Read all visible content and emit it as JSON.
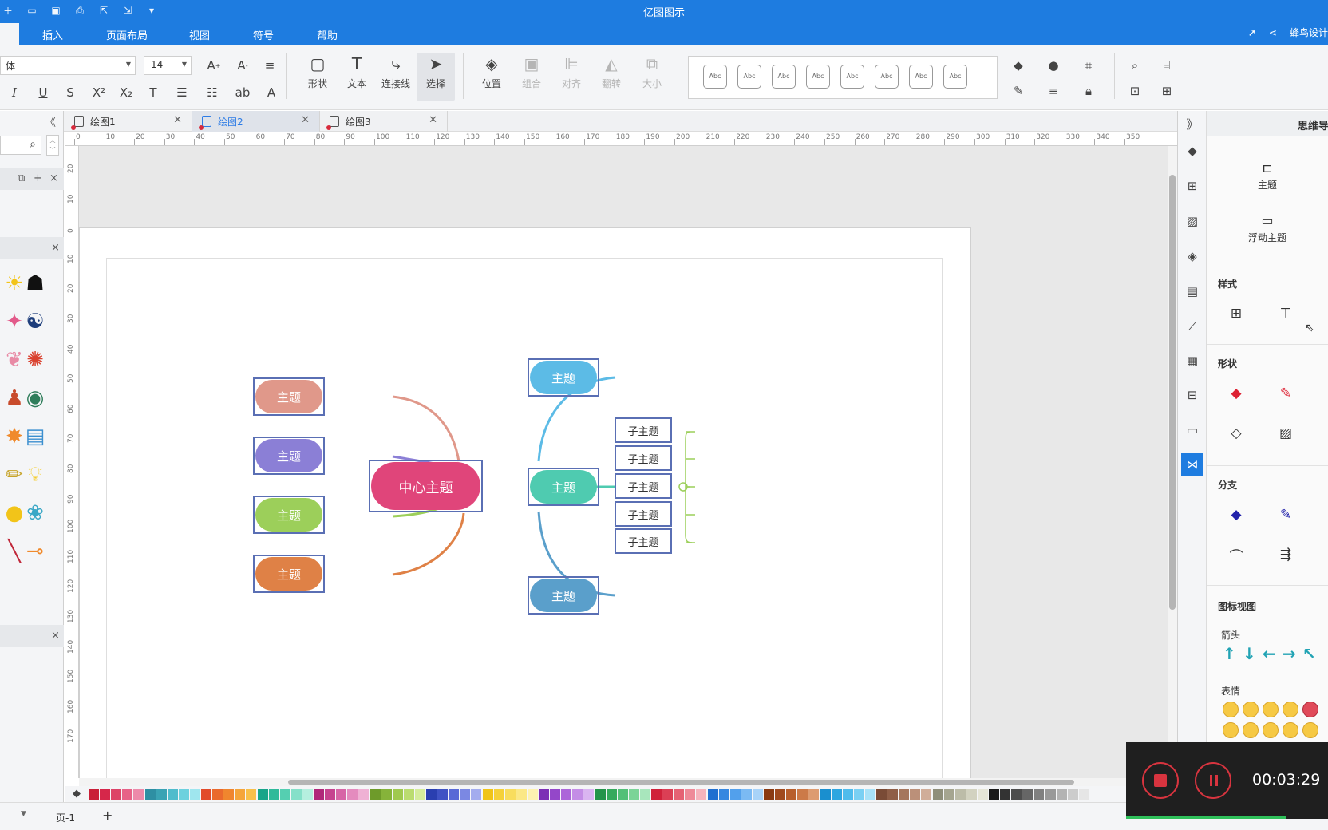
{
  "app": {
    "title": "亿图图示"
  },
  "menu": {
    "items": [
      "插入",
      "页面布局",
      "视图",
      "符号",
      "帮助"
    ],
    "user": "蜂鸟设计"
  },
  "ribbon": {
    "font_name": "体",
    "font_size": "14",
    "tools": {
      "shape": "形状",
      "text": "文本",
      "connector": "连接线",
      "select": "选择",
      "position": "位置",
      "group": "组合",
      "align": "对齐",
      "flip": "翻转",
      "size": "大小"
    },
    "style_chip": "Abc"
  },
  "tabs": [
    {
      "label": "绘图1"
    },
    {
      "label": "绘图2"
    },
    {
      "label": "绘图3"
    }
  ],
  "ruler": {
    "h": [
      "0",
      "10",
      "20",
      "30",
      "40",
      "50",
      "60",
      "70",
      "80",
      "90",
      "100",
      "110",
      "120",
      "130",
      "140",
      "150",
      "160",
      "170",
      "180",
      "190",
      "200",
      "210",
      "220",
      "230",
      "240",
      "250",
      "260",
      "270",
      "280",
      "290",
      "300",
      "310",
      "320",
      "330",
      "340",
      "350"
    ],
    "v": [
      "20",
      "10",
      "0",
      "10",
      "20",
      "30",
      "40",
      "50",
      "60",
      "70",
      "80",
      "90",
      "100",
      "110",
      "120",
      "130",
      "140",
      "150",
      "160",
      "170"
    ]
  },
  "mindmap": {
    "center": "中心主题",
    "left_topics": [
      {
        "label": "主题",
        "color": "#e0988a"
      },
      {
        "label": "主题",
        "color": "#8b7fd6"
      },
      {
        "label": "主题",
        "color": "#9ccf5a"
      },
      {
        "label": "主题",
        "color": "#df8146"
      }
    ],
    "right_topics": [
      {
        "label": "主题",
        "color": "#5cbbe6"
      },
      {
        "label": "主题",
        "color": "#4fcbb0"
      },
      {
        "label": "主题",
        "color": "#5a9fcb"
      }
    ],
    "subtopics": [
      "子主题",
      "子主题",
      "子主题",
      "子主题",
      "子主题"
    ],
    "center_color": "#e0457a"
  },
  "rightpanel": {
    "title": "思维导",
    "topic_btn": "主题",
    "float_topic_btn": "浮动主题",
    "sections": {
      "style": "样式",
      "shape": "形状",
      "branch": "分支",
      "icon_view": "图标视图"
    },
    "subs": {
      "arrow": "箭头",
      "emoji": "表情"
    }
  },
  "statusbar": {
    "page": "页-1",
    "add": "+"
  },
  "recorder": {
    "time": "00:03:29"
  },
  "palette": [
    "#c91f37",
    "#d6274a",
    "#dd4367",
    "#e76287",
    "#ed8aaa",
    "#2e8fa3",
    "#3aa3b4",
    "#4fbccc",
    "#6dd1de",
    "#9fe6ee",
    "#e24b2a",
    "#ea6a2d",
    "#f0862e",
    "#f5a53a",
    "#f8c04a",
    "#18a589",
    "#2fba9a",
    "#55cfb1",
    "#85e0c9",
    "#b5efdf",
    "#b0287a",
    "#c6438f",
    "#d765a6",
    "#e48bbe",
    "#efb1d4",
    "#6e9b2a",
    "#86b33a",
    "#a0c94f",
    "#bbdc70",
    "#d5ec9c",
    "#2a3fb0",
    "#3f52c4",
    "#5969d6",
    "#7b88e3",
    "#a3acee",
    "#f0c419",
    "#f5d13a",
    "#f8dd5e",
    "#fbe886",
    "#fdf2b2",
    "#7c2fb5",
    "#9447c9",
    "#ac66d9",
    "#c48de6",
    "#dab5f1",
    "#24944a",
    "#35aa5c",
    "#52c077",
    "#7bd497",
    "#a8e6bc",
    "#d0213a",
    "#db3f55",
    "#e56274",
    "#ee8a98",
    "#f5b3bc",
    "#1f6fd0",
    "#3587e0",
    "#52a0ec",
    "#7bbaf3",
    "#a8d3f8",
    "#8a3b12",
    "#a04a1d",
    "#b85f2c",
    "#cc7a48",
    "#dd9b70",
    "#1a8fcf",
    "#2ea6e0",
    "#4fbcec",
    "#7ad0f3",
    "#a8e2f8",
    "#7a4b36",
    "#8f5e47",
    "#a5765d",
    "#bb9079",
    "#d0ad99",
    "#8e8e7a",
    "#a5a590",
    "#bcbca8",
    "#d2d2c0",
    "#e6e6d8",
    "#1a1a1a",
    "#333333",
    "#4d4d4d",
    "#666666",
    "#808080",
    "#999999",
    "#b3b3b3",
    "#cccccc",
    "#e6e6e6"
  ]
}
